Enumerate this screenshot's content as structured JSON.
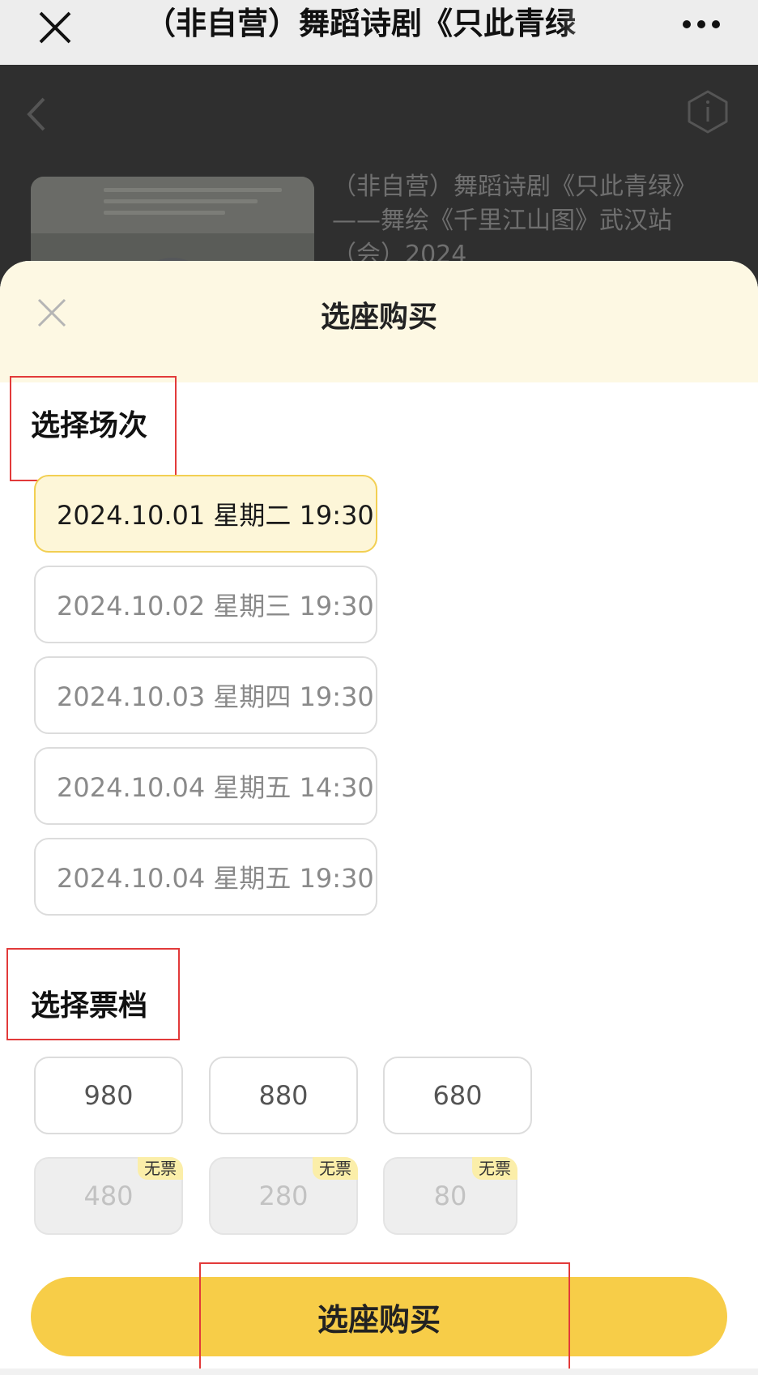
{
  "top_bar": {
    "title": "（非自营）舞蹈诗剧《只此青绿",
    "close_icon": "close-icon",
    "more_icon": "more-icon"
  },
  "background_page": {
    "show_title": "（非自营）舞蹈诗剧《只此青绿》——舞绘《千里江山图》武汉站（会）2024"
  },
  "sheet": {
    "title": "选座购买",
    "session_section_title": "选择场次",
    "sessions": [
      {
        "label": "2024.10.01 星期二 19:30",
        "selected": true
      },
      {
        "label": "2024.10.02 星期三 19:30",
        "selected": false
      },
      {
        "label": "2024.10.03 星期四 19:30",
        "selected": false
      },
      {
        "label": "2024.10.04 星期五 14:30",
        "selected": false
      },
      {
        "label": "2024.10.04 星期五 19:30",
        "selected": false
      }
    ],
    "price_section_title": "选择票档",
    "prices": [
      {
        "label": "980",
        "available": true
      },
      {
        "label": "880",
        "available": true
      },
      {
        "label": "680",
        "available": true
      },
      {
        "label": "480",
        "available": false,
        "tag": "无票"
      },
      {
        "label": "280",
        "available": false,
        "tag": "无票"
      },
      {
        "label": "80",
        "available": false,
        "tag": "无票"
      }
    ],
    "buy_button_label": "选座购买"
  },
  "colors": {
    "accent": "#f7cd48",
    "selected_bg": "#fdf6d8",
    "annotation": "#e23a3a"
  }
}
